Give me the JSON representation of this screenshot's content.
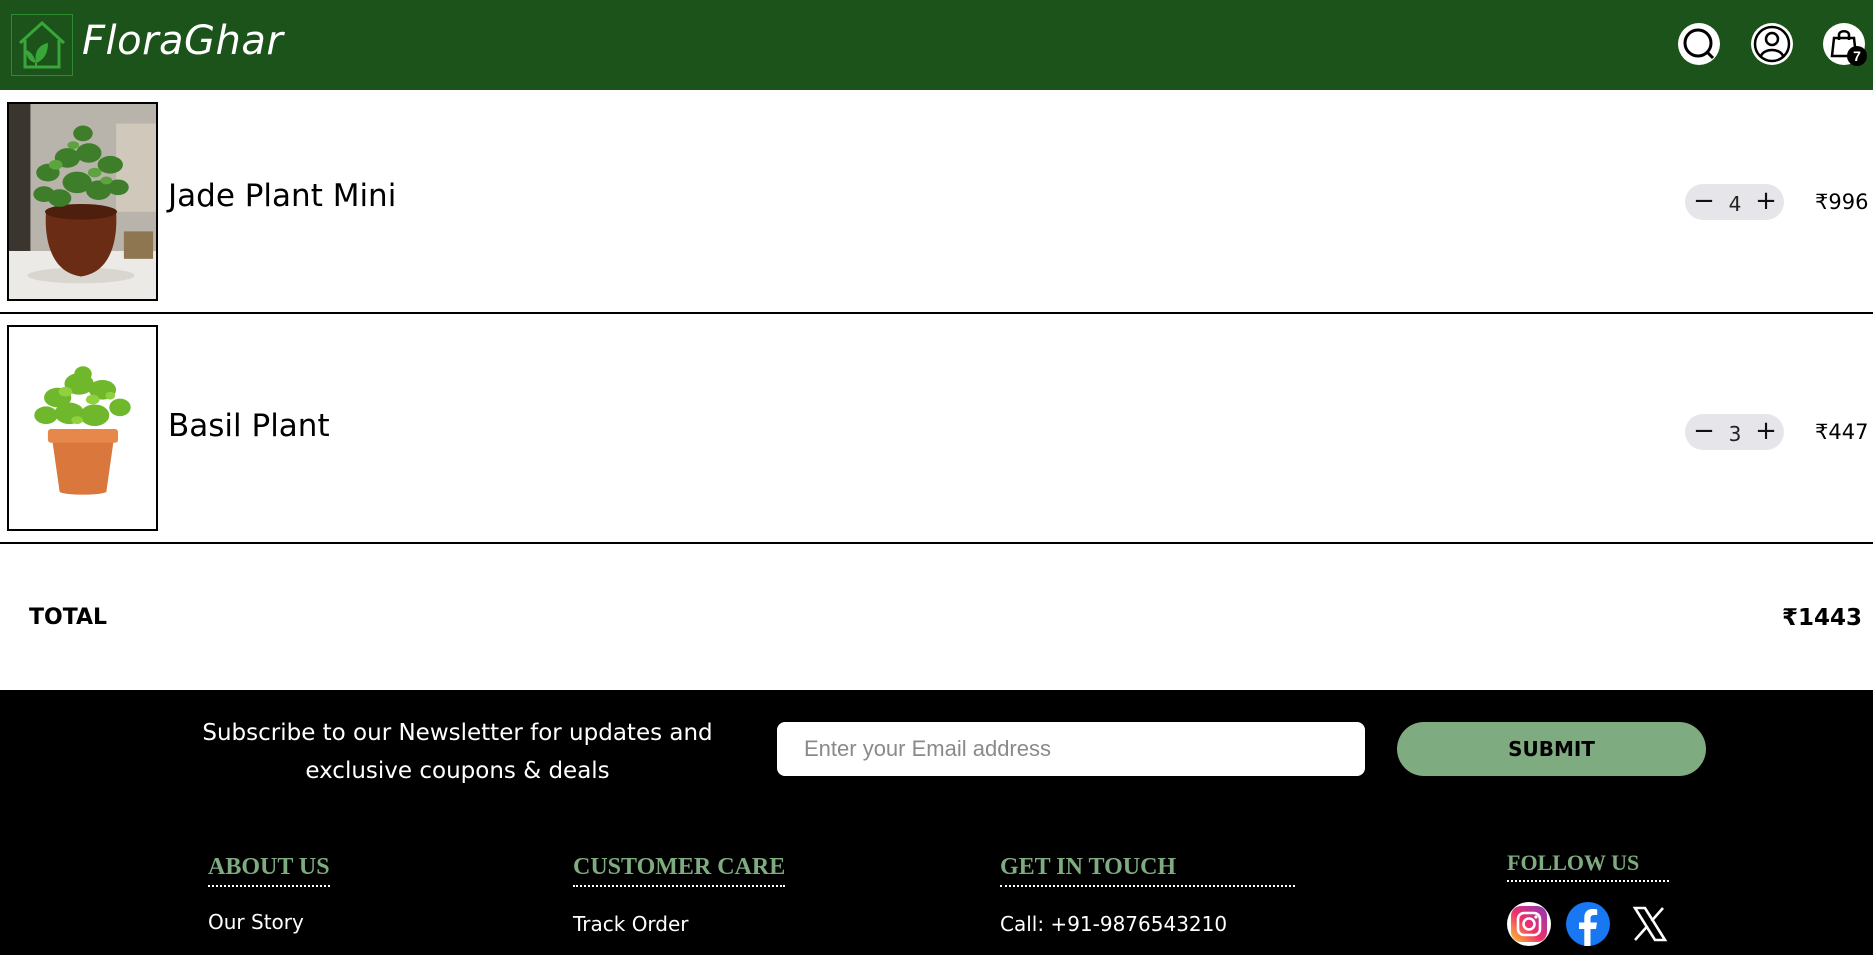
{
  "header": {
    "brand": "FloraGhar",
    "cart_count": "7",
    "colors": {
      "header_bg": "#1b531b",
      "accent": "#7fab80"
    },
    "icons": [
      "home-leaf-logo-icon",
      "search-icon",
      "user-icon",
      "shopping-bag-icon"
    ]
  },
  "cart": {
    "items": [
      {
        "name": "Jade Plant Mini",
        "quantity": "4",
        "price": "₹996",
        "image": "jade-plant-image",
        "minus": "−",
        "plus": "+"
      },
      {
        "name": "Basil Plant",
        "quantity": "3",
        "price": "₹447",
        "image": "basil-plant-image",
        "minus": "−",
        "plus": "+"
      }
    ],
    "total_label": "TOTAL",
    "total_value": "₹1443"
  },
  "footer": {
    "newsletter_text": "Subscribe to our Newsletter for updates and exclusive coupons & deals",
    "email_placeholder": "Enter your Email address",
    "submit_label": "SUBMIT",
    "columns": {
      "about": {
        "heading": "ABOUT US",
        "first_link": "Our Story"
      },
      "care": {
        "heading": "CUSTOMER CARE",
        "first_link": "Track Order"
      },
      "contact": {
        "heading": "GET IN TOUCH",
        "first_link": "Call: +91-9876543210"
      },
      "follow": {
        "heading": "FOLLOW US",
        "socials": [
          "instagram-icon",
          "facebook-icon",
          "x-twitter-icon"
        ]
      }
    }
  }
}
